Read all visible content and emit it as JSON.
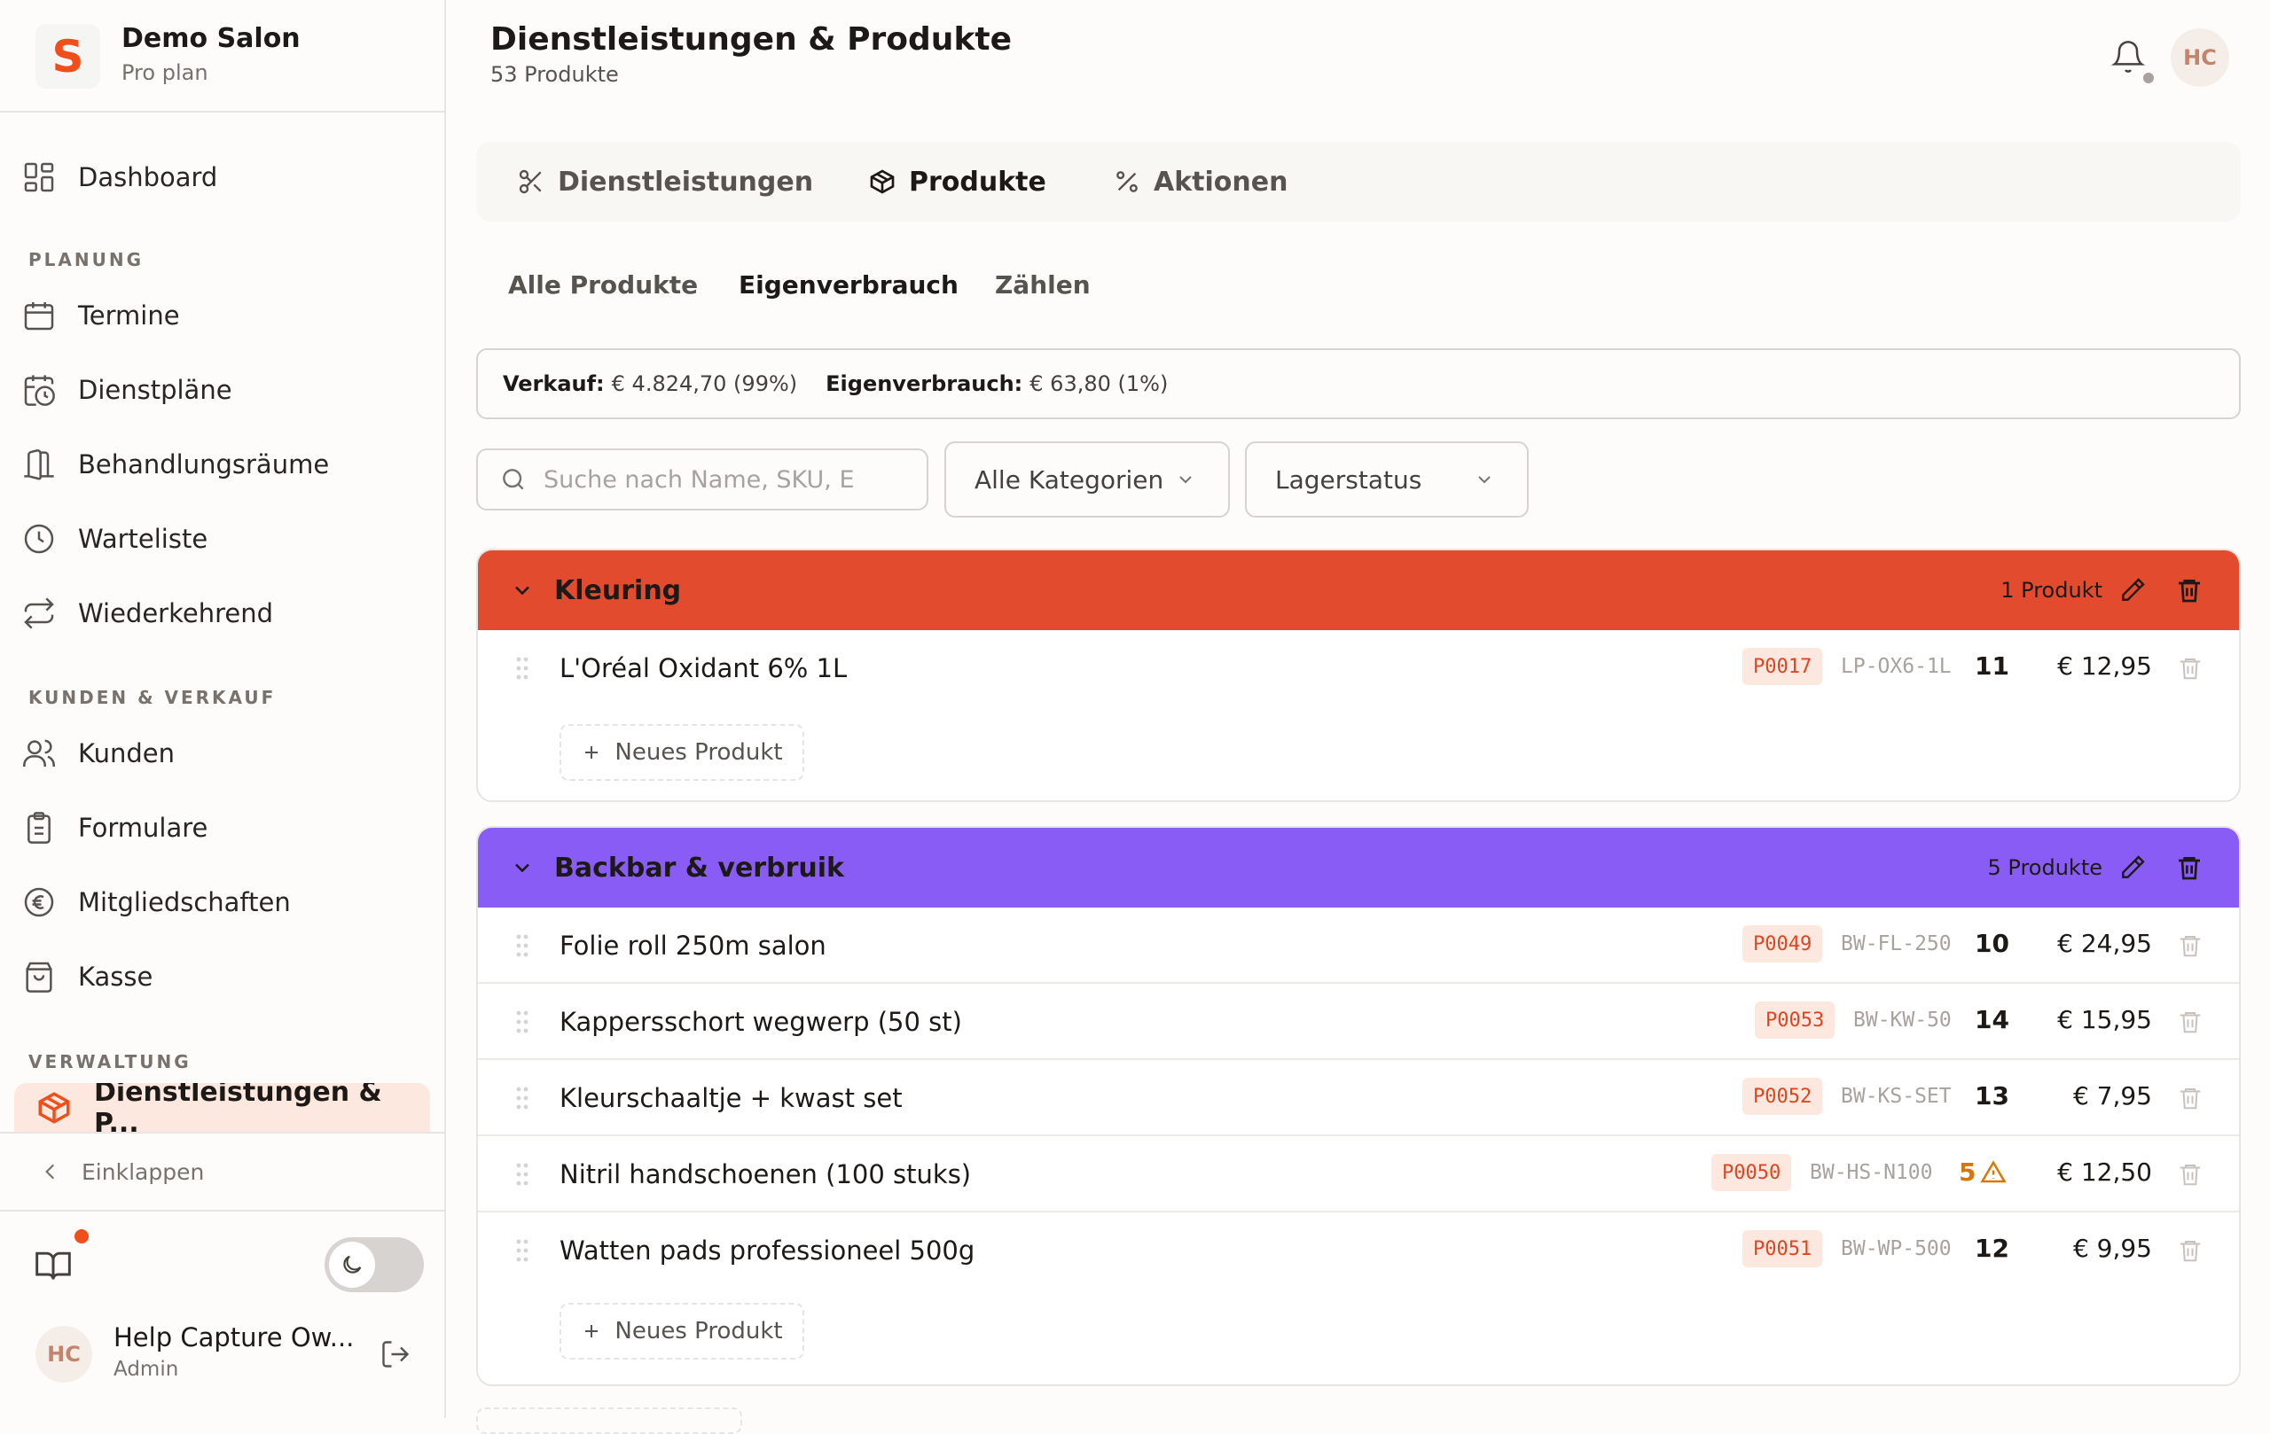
{
  "sidebar": {
    "brand_letter": "S",
    "brand_name": "Demo Salon",
    "brand_plan": "Pro plan",
    "dashboard": "Dashboard",
    "section_planung": "PLANUNG",
    "planung": [
      "Termine",
      "Dienstpläne",
      "Behandlungsräume",
      "Warteliste",
      "Wiederkehrend"
    ],
    "section_kunden": "KUNDEN & VERKAUF",
    "kunden": [
      "Kunden",
      "Formulare",
      "Mitgliedschaften",
      "Kasse"
    ],
    "section_verwaltung": "VERWALTUNG",
    "active_item": "Dienstleistungen & P...",
    "collapse": "Einklappen",
    "user_initials": "HC",
    "user_name": "Help Capture Ow...",
    "user_role": "Admin"
  },
  "header": {
    "title": "Dienstleistungen & Produkte",
    "subtitle": "53 Produkte",
    "avatar_initials": "HC"
  },
  "tabs": [
    "Dienstleistungen",
    "Produkte",
    "Aktionen"
  ],
  "subtabs": [
    "Alle Produkte",
    "Eigenverbrauch",
    "Zählen"
  ],
  "summary": {
    "verkauf_label": "Verkauf:",
    "verkauf_value": "€ 4.824,70 (99%)",
    "eigen_label": "Eigenverbrauch:",
    "eigen_value": "€ 63,80 (1%)"
  },
  "filters": {
    "search_placeholder": "Suche nach Name, SKU, E",
    "category": "Alle Kategorien",
    "stock": "Lagerstatus"
  },
  "groups": [
    {
      "name": "Kleuring",
      "count": "1 Produkt",
      "color": "#e34b2e",
      "products": [
        {
          "name": "L'Oréal Oxidant 6% 1L",
          "code": "P0017",
          "sku": "LP-OX6-1L",
          "qty": "11",
          "price": "€ 12,95"
        }
      ],
      "new_label": "Neues Produkt"
    },
    {
      "name": "Backbar & verbruik",
      "count": "5 Produkte",
      "color": "#8a5cf6",
      "products": [
        {
          "name": "Folie roll 250m salon",
          "code": "P0049",
          "sku": "BW-FL-250",
          "qty": "10",
          "price": "€ 24,95"
        },
        {
          "name": "Kappersschort wegwerp (50 st)",
          "code": "P0053",
          "sku": "BW-KW-50",
          "qty": "14",
          "price": "€ 15,95"
        },
        {
          "name": "Kleurschaaltje + kwast set",
          "code": "P0052",
          "sku": "BW-KS-SET",
          "qty": "13",
          "price": "€ 7,95"
        },
        {
          "name": "Nitril handschoenen (100 stuks)",
          "code": "P0050",
          "sku": "BW-HS-N100",
          "qty": "5",
          "price": "€ 12,50",
          "low_stock": true
        },
        {
          "name": "Watten pads professioneel 500g",
          "code": "P0051",
          "sku": "BW-WP-500",
          "qty": "12",
          "price": "€ 9,95"
        }
      ],
      "new_label": "Neues Produkt"
    }
  ]
}
